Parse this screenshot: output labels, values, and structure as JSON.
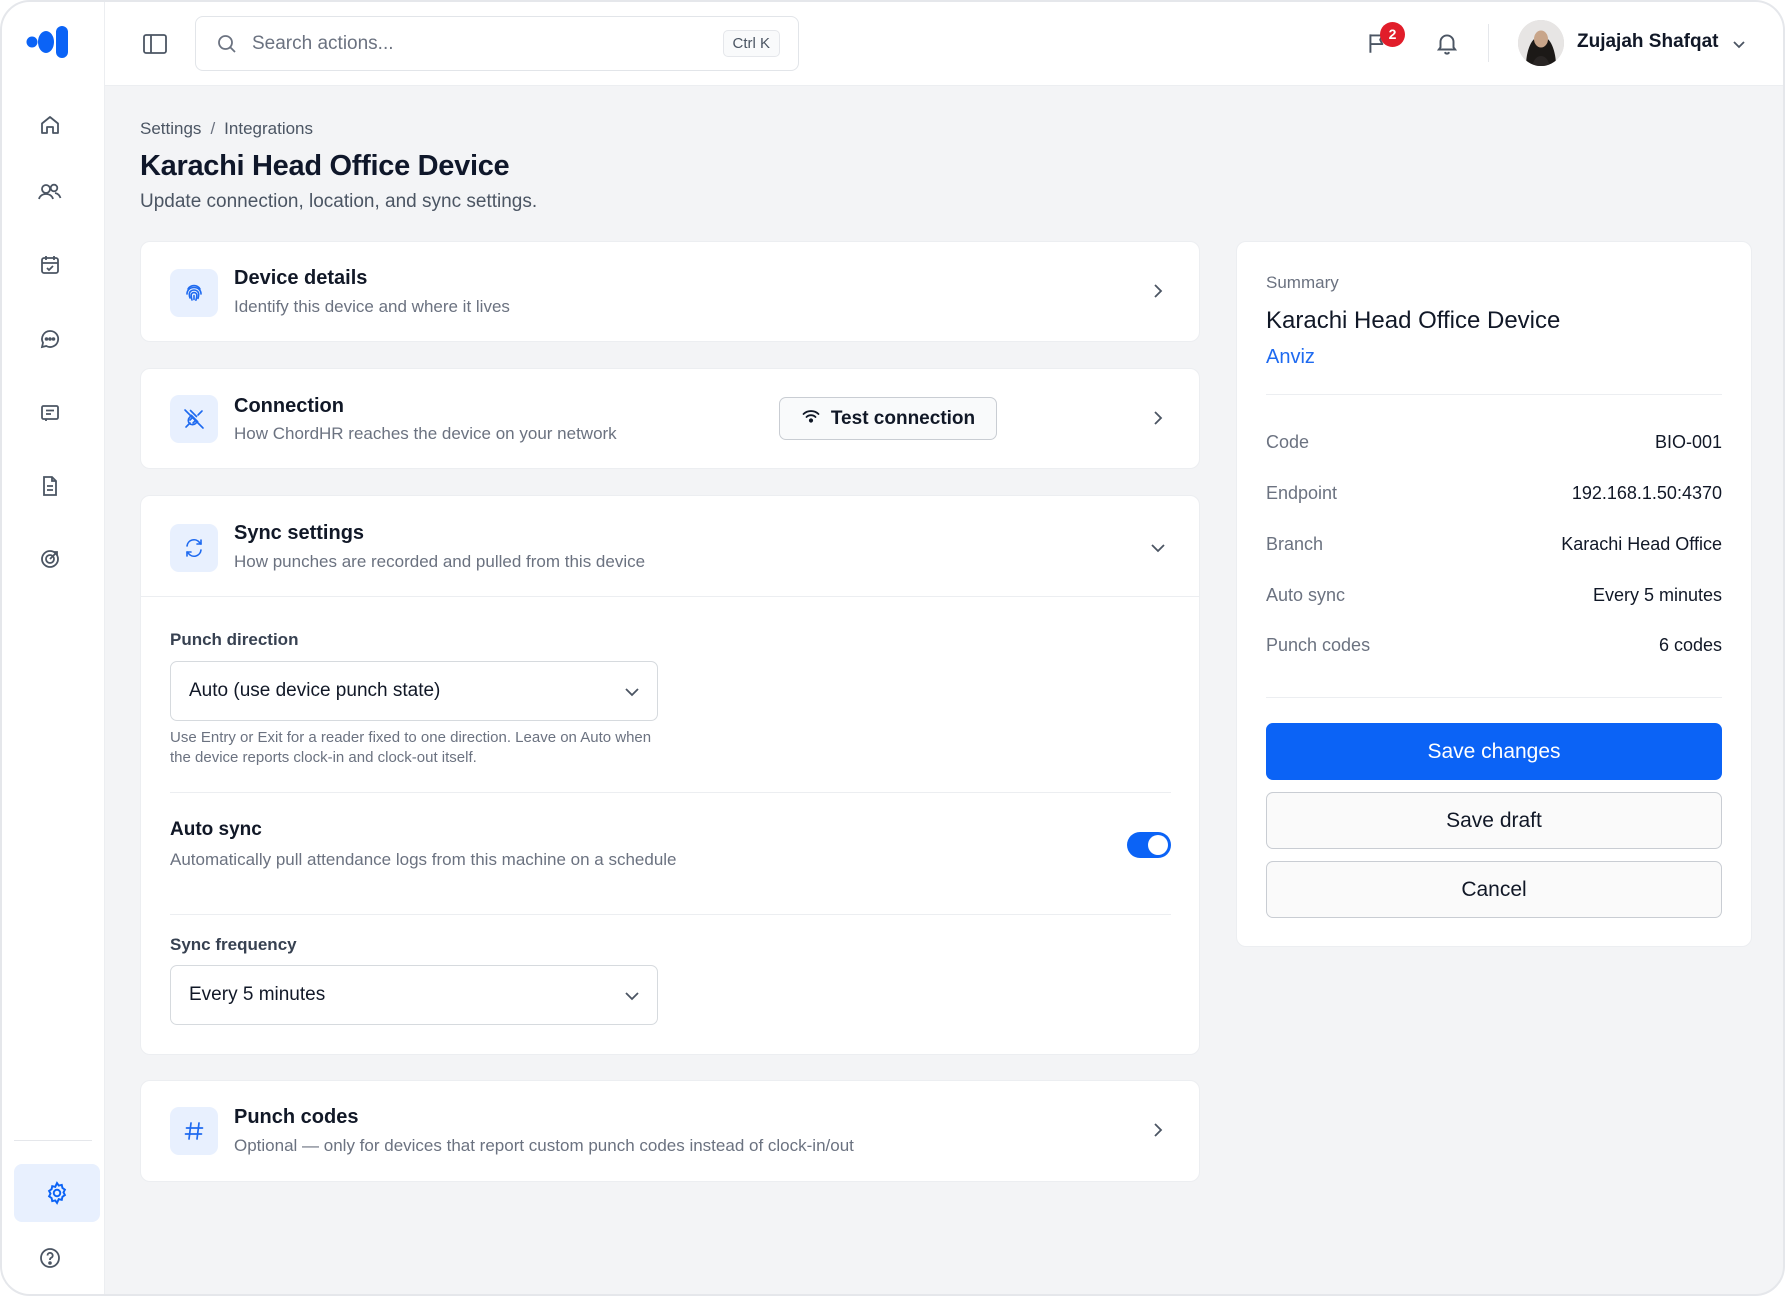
{
  "app": {
    "search_placeholder": "Search actions...",
    "search_shortcut": "Ctrl K",
    "notification_badge": "2",
    "user_name": "Zujajah Shafqat"
  },
  "sidebar": {
    "items": [
      {
        "icon": "home-icon"
      },
      {
        "icon": "users-icon"
      },
      {
        "icon": "calendar-check-icon"
      },
      {
        "icon": "chat-icon"
      },
      {
        "icon": "message-square-icon"
      },
      {
        "icon": "document-icon"
      },
      {
        "icon": "target-icon"
      }
    ],
    "bottom": [
      {
        "icon": "settings-icon",
        "active": true
      },
      {
        "icon": "help-icon"
      }
    ]
  },
  "page": {
    "breadcrumb": [
      "Settings",
      "Integrations"
    ],
    "title": "Karachi Head Office Device",
    "subtitle": "Update connection, location, and sync settings."
  },
  "sections": {
    "device_details": {
      "title": "Device details",
      "desc": "Identify this device and where it lives"
    },
    "connection": {
      "title": "Connection",
      "desc": "How ChordHR reaches the device on your network",
      "test_button": "Test connection"
    },
    "sync": {
      "title": "Sync settings",
      "desc": "How punches are recorded and pulled from this device",
      "punch_direction_label": "Punch direction",
      "punch_direction_value": "Auto (use device punch state)",
      "punch_direction_help": "Use Entry or Exit for a reader fixed to one direction. Leave on Auto when the device reports clock-in and clock-out itself.",
      "auto_sync_title": "Auto sync",
      "auto_sync_desc": "Automatically pull attendance logs from this machine on a schedule",
      "auto_sync_enabled": true,
      "frequency_label": "Sync frequency",
      "frequency_value": "Every 5 minutes"
    },
    "punch_codes": {
      "title": "Punch codes",
      "desc": "Optional — only for devices that report custom punch codes instead of clock-in/out"
    }
  },
  "summary": {
    "label": "Summary",
    "title": "Karachi Head Office Device",
    "vendor": "Anviz",
    "rows": [
      {
        "key": "Code",
        "value": "BIO-001"
      },
      {
        "key": "Endpoint",
        "value": "192.168.1.50:4370"
      },
      {
        "key": "Branch",
        "value": "Karachi Head Office"
      },
      {
        "key": "Auto sync",
        "value": "Every 5 minutes"
      },
      {
        "key": "Punch codes",
        "value": "6 codes"
      }
    ],
    "save_label": "Save changes",
    "draft_label": "Save draft",
    "cancel_label": "Cancel"
  },
  "colors": {
    "accent": "#0b63f6",
    "badge": "#e11d2a",
    "background": "#f3f4f6"
  }
}
